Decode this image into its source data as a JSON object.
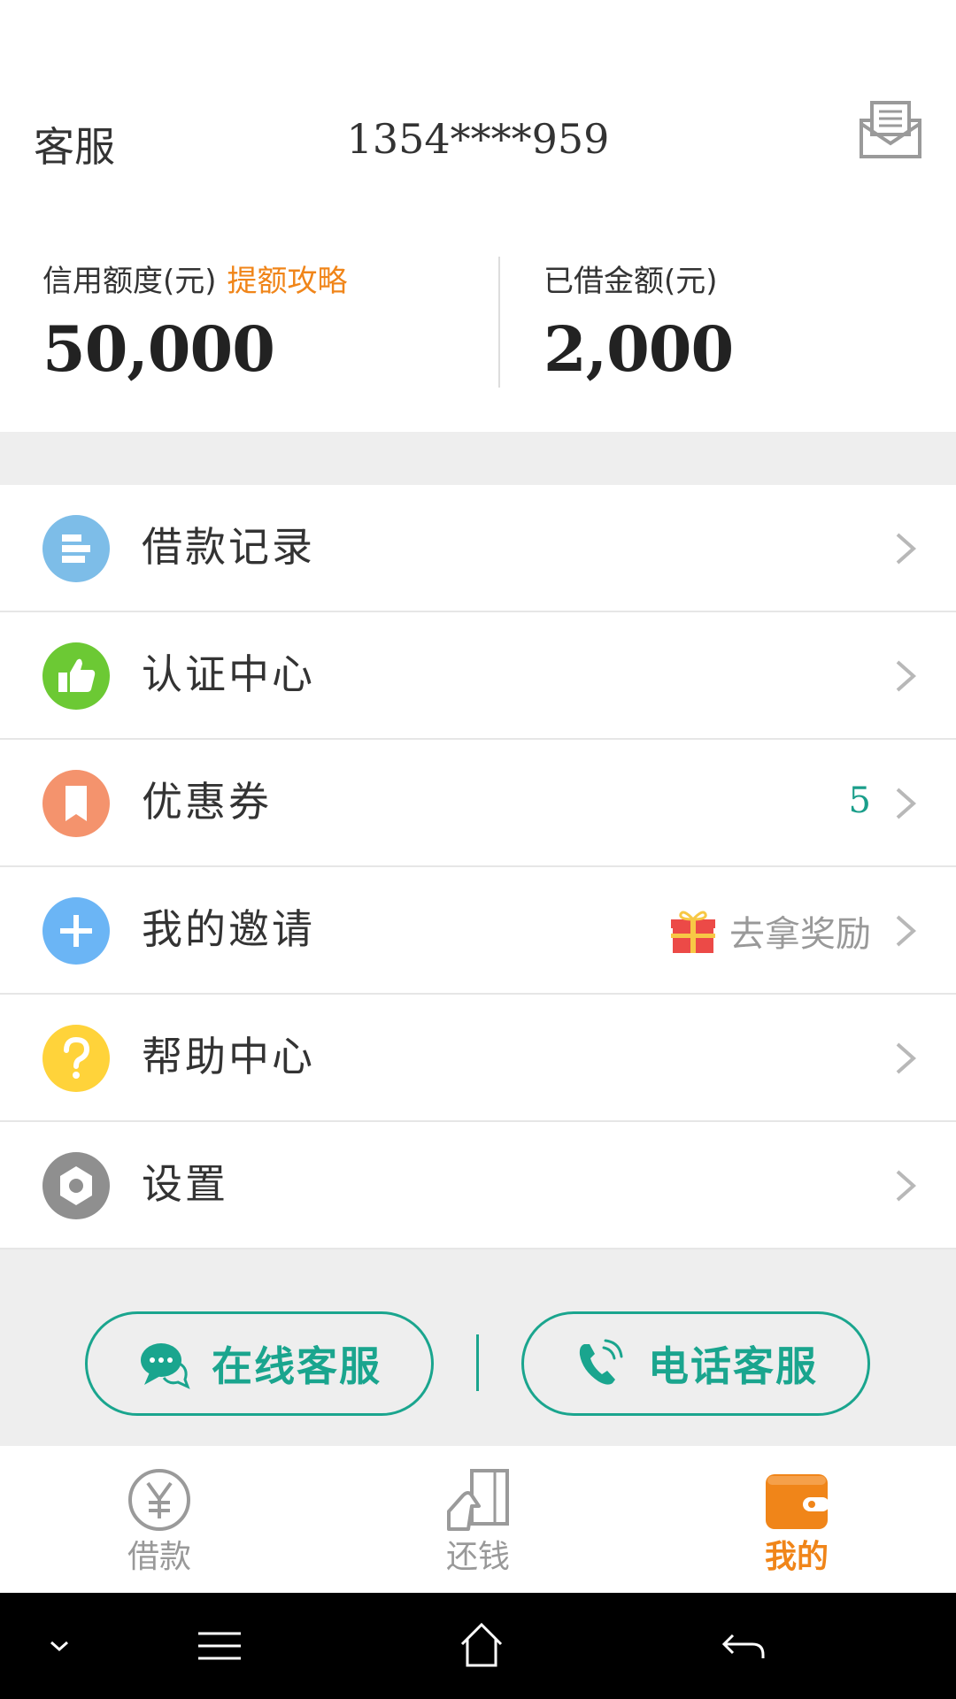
{
  "header": {
    "service_label": "客服",
    "phone": "1354****959",
    "mail_icon": "mail-icon"
  },
  "credit": {
    "limit_label": "信用额度(元)",
    "limit_link": "提额攻略",
    "limit_value": "50,000",
    "borrowed_label": "已借金额(元)",
    "borrowed_value": "2,000"
  },
  "menu": {
    "items": [
      {
        "label": "借款记录",
        "icon": "loan-record-icon",
        "color": "#7dbde8"
      },
      {
        "label": "认证中心",
        "icon": "thumbs-up-icon",
        "color": "#6cc934"
      },
      {
        "label": "优惠券",
        "icon": "coupon-icon",
        "color": "#f4936d",
        "count": "5"
      },
      {
        "label": "我的邀请",
        "icon": "plus-icon",
        "color": "#6bb5f5",
        "extra": "去拿奖励"
      },
      {
        "label": "帮助中心",
        "icon": "question-icon",
        "color": "#ffd33a"
      },
      {
        "label": "设置",
        "icon": "gear-icon",
        "color": "#8f8f8f"
      }
    ]
  },
  "service": {
    "online_label": "在线客服",
    "phone_label": "电话客服"
  },
  "tabs": [
    {
      "label": "借款",
      "icon": "yuan-icon"
    },
    {
      "label": "还钱",
      "icon": "repay-icon"
    },
    {
      "label": "我的",
      "icon": "wallet-icon",
      "active": true
    }
  ],
  "colors": {
    "accent_orange": "#f08519",
    "accent_green": "#1aa58e",
    "band_gray": "#eeeeee"
  }
}
